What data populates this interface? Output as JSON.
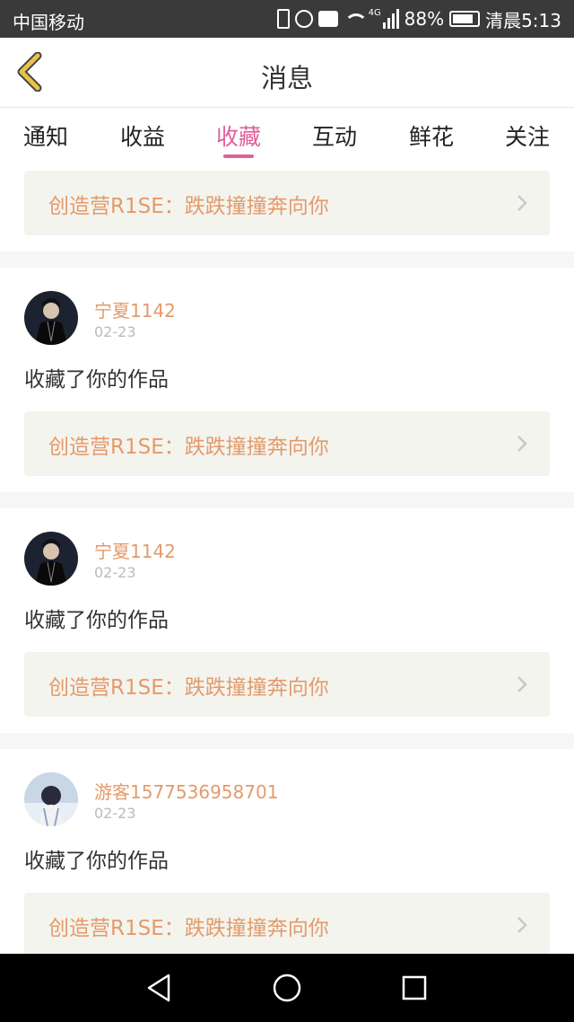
{
  "status_bar": {
    "carrier": "中国移动",
    "network": "4G",
    "battery": "88%",
    "time": "清晨5:13"
  },
  "header": {
    "title": "消息"
  },
  "tabs": [
    {
      "label": "通知",
      "active": false
    },
    {
      "label": "收益",
      "active": false
    },
    {
      "label": "收藏",
      "active": true
    },
    {
      "label": "互动",
      "active": false
    },
    {
      "label": "鲜花",
      "active": false
    },
    {
      "label": "关注",
      "active": false
    }
  ],
  "feed": {
    "top_link": "创造营R1SE：跌跌撞撞奔向你",
    "items": [
      {
        "username": "宁夏1142",
        "date": "02-23",
        "message": "收藏了你的作品",
        "link": "创造营R1SE：跌跌撞撞奔向你"
      },
      {
        "username": "宁夏1142",
        "date": "02-23",
        "message": "收藏了你的作品",
        "link": "创造营R1SE：跌跌撞撞奔向你"
      },
      {
        "username": "游客1577536958701",
        "date": "02-23",
        "message": "收藏了你的作品",
        "link": "创造营R1SE：跌跌撞撞奔向你"
      }
    ]
  },
  "colors": {
    "accent": "#e0609a",
    "link_text": "#e49a6a",
    "back_arrow": "#e8c24a"
  },
  "icons": {
    "back": "chevron-left-icon",
    "chevron": "chevron-right-icon",
    "nav_back": "triangle-back-icon",
    "nav_home": "circle-home-icon",
    "nav_recent": "square-recents-icon"
  }
}
